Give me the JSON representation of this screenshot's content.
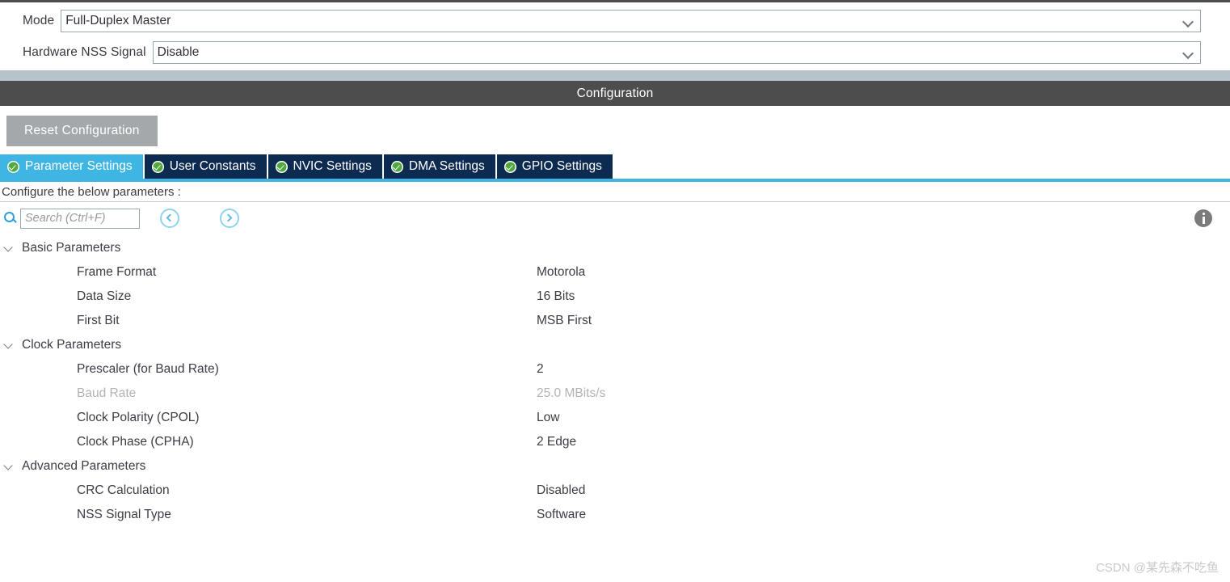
{
  "form": {
    "fields": [
      {
        "label": "Mode",
        "value": "Full-Duplex Master",
        "icon": "chevron-down-icon"
      },
      {
        "label": "Hardware NSS Signal",
        "value": "Disable",
        "icon": "chevron-down-icon"
      }
    ]
  },
  "config_header": {
    "title": "Configuration"
  },
  "toolbar": {
    "reset_label": "Reset Configuration"
  },
  "tabs": [
    {
      "label": "Parameter Settings",
      "active": true,
      "status_icon": "check-circle-icon"
    },
    {
      "label": "User Constants",
      "active": false,
      "status_icon": "check-circle-icon"
    },
    {
      "label": "NVIC Settings",
      "active": false,
      "status_icon": "check-circle-icon"
    },
    {
      "label": "DMA Settings",
      "active": false,
      "status_icon": "check-circle-icon"
    },
    {
      "label": "GPIO Settings",
      "active": false,
      "status_icon": "check-circle-icon"
    }
  ],
  "hint": {
    "text": "Configure the below parameters :"
  },
  "search": {
    "placeholder": "Search (Ctrl+F)",
    "value": "",
    "search_icon": "search-icon",
    "prev_icon": "chevron-left-circle-icon",
    "next_icon": "chevron-right-circle-icon",
    "info_icon": "info-icon"
  },
  "tree": {
    "groups": [
      {
        "label": "Basic Parameters",
        "expanded": true,
        "rows": [
          {
            "name": "Frame Format",
            "value": "Motorola",
            "disabled": false
          },
          {
            "name": "Data Size",
            "value": "16 Bits",
            "disabled": false
          },
          {
            "name": "First Bit",
            "value": "MSB First",
            "disabled": false
          }
        ]
      },
      {
        "label": "Clock Parameters",
        "expanded": true,
        "rows": [
          {
            "name": "Prescaler (for Baud Rate)",
            "value": "2",
            "disabled": false
          },
          {
            "name": "Baud Rate",
            "value": "25.0 MBits/s",
            "disabled": true
          },
          {
            "name": "Clock Polarity (CPOL)",
            "value": "Low",
            "disabled": false
          },
          {
            "name": "Clock Phase (CPHA)",
            "value": "2 Edge",
            "disabled": false
          }
        ]
      },
      {
        "label": "Advanced Parameters",
        "expanded": true,
        "rows": [
          {
            "name": "CRC Calculation",
            "value": "Disabled",
            "disabled": false
          },
          {
            "name": "NSS Signal Type",
            "value": "Software",
            "disabled": false
          }
        ]
      }
    ]
  },
  "watermark": {
    "text": "CSDN @某先森不吃鱼"
  },
  "colors": {
    "accent_cyan": "#3fb5e3",
    "tab_inactive": "#0d2a50",
    "header_bar": "#4d4d4d",
    "separator_strip": "#b6c3cb",
    "check_green": "#4fa93f",
    "reset_gray": "#a4a8ab",
    "disabled_text": "#b3b3b3"
  }
}
